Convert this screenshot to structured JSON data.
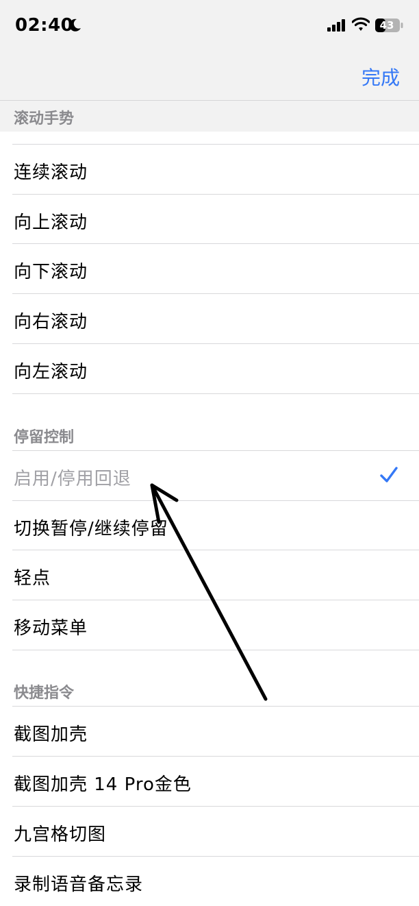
{
  "status_bar": {
    "time": "02:40",
    "battery": "43",
    "moon_icon": "moon-icon",
    "signal_icon": "cellular-signal-icon",
    "wifi_icon": "wifi-icon",
    "battery_icon": "battery-icon"
  },
  "nav": {
    "done_label": "完成",
    "accent_color": "#3478f6"
  },
  "sections": [
    {
      "title": "滚动手势",
      "items": [
        "连续滚动",
        "向上滚动",
        "向下滚动",
        "向右滚动",
        "向左滚动"
      ]
    },
    {
      "title": "停留控制",
      "items": [
        "启用/停用回退",
        "切换暂停/继续停留",
        "轻点",
        "移动菜单"
      ],
      "selected": "启用/停用回退"
    },
    {
      "title": "快捷指令",
      "items": [
        "截图加壳",
        "截图加壳 14 Pro金色",
        "九宫格切图",
        "录制语音备忘录"
      ]
    }
  ]
}
